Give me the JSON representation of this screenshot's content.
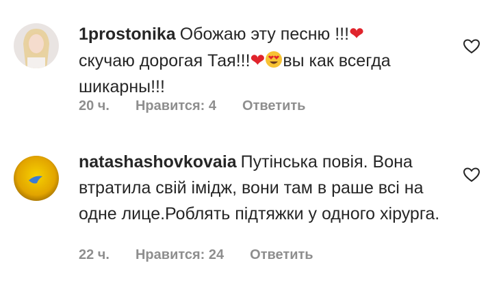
{
  "comments": [
    {
      "username": "1prostonika",
      "text_part1": "Обожаю эту песню !!!",
      "text_part2": "скучаю дорогая Тая!!!",
      "text_part3": "вы как всегда шикарны!!!",
      "heart_emoji": "❤",
      "time": "20 ч.",
      "likes": "Нравится: 4",
      "reply_label": "Ответить",
      "like_icon": "heart-outline-icon"
    },
    {
      "username": "natashashovkovaia",
      "text": "Путінська повія. Вона втратила свій імідж, вони там в раше всі на одне лице.Роблять підтяжки у одного хірурга.",
      "time": "22 ч.",
      "likes": "Нравится: 24",
      "reply_label": "Ответить",
      "like_icon": "heart-outline-icon"
    }
  ]
}
